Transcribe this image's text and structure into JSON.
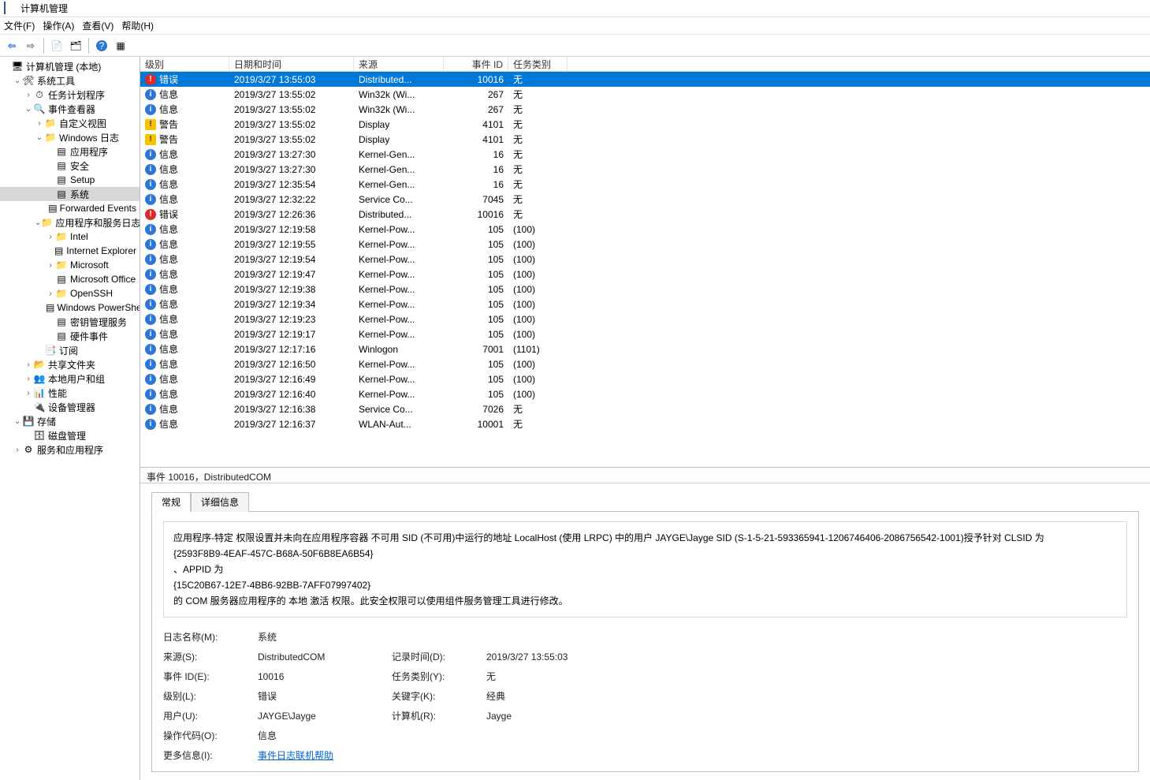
{
  "window": {
    "title": "计算机管理"
  },
  "menu": {
    "file": "文件(F)",
    "action": "操作(A)",
    "view": "查看(V)",
    "help": "帮助(H)"
  },
  "toolbar": {
    "back": "back-arrow",
    "forward": "forward-arrow",
    "up": "folder-up",
    "props": "properties",
    "refresh": "refresh",
    "help": "help",
    "export": "export"
  },
  "tree": [
    {
      "depth": 0,
      "exp": "",
      "icon": "comp",
      "label": "计算机管理 (本地)"
    },
    {
      "depth": 1,
      "exp": "v",
      "icon": "tool",
      "label": "系统工具"
    },
    {
      "depth": 2,
      "exp": ">",
      "icon": "clock",
      "label": "任务计划程序"
    },
    {
      "depth": 2,
      "exp": "v",
      "icon": "ev",
      "label": "事件查看器"
    },
    {
      "depth": 3,
      "exp": ">",
      "icon": "folder",
      "label": "自定义视图"
    },
    {
      "depth": 3,
      "exp": "v",
      "icon": "folder",
      "label": "Windows 日志"
    },
    {
      "depth": 4,
      "exp": "",
      "icon": "log",
      "label": "应用程序"
    },
    {
      "depth": 4,
      "exp": "",
      "icon": "log",
      "label": "安全"
    },
    {
      "depth": 4,
      "exp": "",
      "icon": "log",
      "label": "Setup"
    },
    {
      "depth": 4,
      "exp": "",
      "icon": "log",
      "label": "系统",
      "selected": true
    },
    {
      "depth": 4,
      "exp": "",
      "icon": "log",
      "label": "Forwarded Events"
    },
    {
      "depth": 3,
      "exp": "v",
      "icon": "folder",
      "label": "应用程序和服务日志"
    },
    {
      "depth": 4,
      "exp": ">",
      "icon": "folder",
      "label": "Intel"
    },
    {
      "depth": 4,
      "exp": "",
      "icon": "log",
      "label": "Internet Explorer"
    },
    {
      "depth": 4,
      "exp": ">",
      "icon": "folder",
      "label": "Microsoft"
    },
    {
      "depth": 4,
      "exp": "",
      "icon": "log",
      "label": "Microsoft Office"
    },
    {
      "depth": 4,
      "exp": ">",
      "icon": "folder",
      "label": "OpenSSH"
    },
    {
      "depth": 4,
      "exp": "",
      "icon": "log",
      "label": "Windows PowerShell"
    },
    {
      "depth": 4,
      "exp": "",
      "icon": "log",
      "label": "密钥管理服务"
    },
    {
      "depth": 4,
      "exp": "",
      "icon": "log",
      "label": "硬件事件"
    },
    {
      "depth": 3,
      "exp": "",
      "icon": "sub",
      "label": "订阅"
    },
    {
      "depth": 2,
      "exp": ">",
      "icon": "share",
      "label": "共享文件夹"
    },
    {
      "depth": 2,
      "exp": ">",
      "icon": "users",
      "label": "本地用户和组"
    },
    {
      "depth": 2,
      "exp": ">",
      "icon": "perf",
      "label": "性能"
    },
    {
      "depth": 2,
      "exp": "",
      "icon": "dev",
      "label": "设备管理器"
    },
    {
      "depth": 1,
      "exp": "v",
      "icon": "store",
      "label": "存储"
    },
    {
      "depth": 2,
      "exp": "",
      "icon": "disk",
      "label": "磁盘管理"
    },
    {
      "depth": 1,
      "exp": ">",
      "icon": "svc",
      "label": "服务和应用程序"
    }
  ],
  "columns": {
    "level": "级别",
    "date": "日期和时间",
    "source": "来源",
    "id": "事件 ID",
    "category": "任务类别"
  },
  "events": [
    {
      "lvl": "err",
      "level": "错误",
      "date": "2019/3/27 13:55:03",
      "src": "Distributed...",
      "id": "10016",
      "cat": "无",
      "sel": true
    },
    {
      "lvl": "info",
      "level": "信息",
      "date": "2019/3/27 13:55:02",
      "src": "Win32k (Wi...",
      "id": "267",
      "cat": "无"
    },
    {
      "lvl": "info",
      "level": "信息",
      "date": "2019/3/27 13:55:02",
      "src": "Win32k (Wi...",
      "id": "267",
      "cat": "无"
    },
    {
      "lvl": "warn",
      "level": "警告",
      "date": "2019/3/27 13:55:02",
      "src": "Display",
      "id": "4101",
      "cat": "无"
    },
    {
      "lvl": "warn",
      "level": "警告",
      "date": "2019/3/27 13:55:02",
      "src": "Display",
      "id": "4101",
      "cat": "无"
    },
    {
      "lvl": "info",
      "level": "信息",
      "date": "2019/3/27 13:27:30",
      "src": "Kernel-Gen...",
      "id": "16",
      "cat": "无"
    },
    {
      "lvl": "info",
      "level": "信息",
      "date": "2019/3/27 13:27:30",
      "src": "Kernel-Gen...",
      "id": "16",
      "cat": "无"
    },
    {
      "lvl": "info",
      "level": "信息",
      "date": "2019/3/27 12:35:54",
      "src": "Kernel-Gen...",
      "id": "16",
      "cat": "无"
    },
    {
      "lvl": "info",
      "level": "信息",
      "date": "2019/3/27 12:32:22",
      "src": "Service Co...",
      "id": "7045",
      "cat": "无"
    },
    {
      "lvl": "err",
      "level": "错误",
      "date": "2019/3/27 12:26:36",
      "src": "Distributed...",
      "id": "10016",
      "cat": "无"
    },
    {
      "lvl": "info",
      "level": "信息",
      "date": "2019/3/27 12:19:58",
      "src": "Kernel-Pow...",
      "id": "105",
      "cat": "(100)"
    },
    {
      "lvl": "info",
      "level": "信息",
      "date": "2019/3/27 12:19:55",
      "src": "Kernel-Pow...",
      "id": "105",
      "cat": "(100)"
    },
    {
      "lvl": "info",
      "level": "信息",
      "date": "2019/3/27 12:19:54",
      "src": "Kernel-Pow...",
      "id": "105",
      "cat": "(100)"
    },
    {
      "lvl": "info",
      "level": "信息",
      "date": "2019/3/27 12:19:47",
      "src": "Kernel-Pow...",
      "id": "105",
      "cat": "(100)"
    },
    {
      "lvl": "info",
      "level": "信息",
      "date": "2019/3/27 12:19:38",
      "src": "Kernel-Pow...",
      "id": "105",
      "cat": "(100)"
    },
    {
      "lvl": "info",
      "level": "信息",
      "date": "2019/3/27 12:19:34",
      "src": "Kernel-Pow...",
      "id": "105",
      "cat": "(100)"
    },
    {
      "lvl": "info",
      "level": "信息",
      "date": "2019/3/27 12:19:23",
      "src": "Kernel-Pow...",
      "id": "105",
      "cat": "(100)"
    },
    {
      "lvl": "info",
      "level": "信息",
      "date": "2019/3/27 12:19:17",
      "src": "Kernel-Pow...",
      "id": "105",
      "cat": "(100)"
    },
    {
      "lvl": "info",
      "level": "信息",
      "date": "2019/3/27 12:17:16",
      "src": "Winlogon",
      "id": "7001",
      "cat": "(1101)"
    },
    {
      "lvl": "info",
      "level": "信息",
      "date": "2019/3/27 12:16:50",
      "src": "Kernel-Pow...",
      "id": "105",
      "cat": "(100)"
    },
    {
      "lvl": "info",
      "level": "信息",
      "date": "2019/3/27 12:16:49",
      "src": "Kernel-Pow...",
      "id": "105",
      "cat": "(100)"
    },
    {
      "lvl": "info",
      "level": "信息",
      "date": "2019/3/27 12:16:40",
      "src": "Kernel-Pow...",
      "id": "105",
      "cat": "(100)"
    },
    {
      "lvl": "info",
      "level": "信息",
      "date": "2019/3/27 12:16:38",
      "src": "Service Co...",
      "id": "7026",
      "cat": "无"
    },
    {
      "lvl": "info",
      "level": "信息",
      "date": "2019/3/27 12:16:37",
      "src": "WLAN-Aut...",
      "id": "10001",
      "cat": "无"
    }
  ],
  "detail": {
    "header": "事件 10016，DistributedCOM",
    "tabs": {
      "general": "常规",
      "details": "详细信息"
    },
    "desc_lines": [
      "应用程序-特定 权限设置并未向在应用程序容器 不可用 SID (不可用)中运行的地址 LocalHost (使用 LRPC) 中的用户 JAYGE\\Jayge SID (S-1-5-21-593365941-1206746406-2086756542-1001)授予针对 CLSID 为",
      "{2593F8B9-4EAF-457C-B68A-50F6B8EA6B54}",
      "、APPID 为",
      "{15C20B67-12E7-4BB6-92BB-7AFF07997402}",
      "的 COM 服务器应用程序的 本地 激活 权限。此安全权限可以使用组件服务管理工具进行修改。"
    ],
    "props": {
      "logname_k": "日志名称(M):",
      "logname_v": "系统",
      "source_k": "来源(S):",
      "source_v": "DistributedCOM",
      "logged_k": "记录时间(D):",
      "logged_v": "2019/3/27 13:55:03",
      "eventid_k": "事件 ID(E):",
      "eventid_v": "10016",
      "taskcat_k": "任务类别(Y):",
      "taskcat_v": "无",
      "level_k": "级别(L):",
      "level_v": "错误",
      "keywords_k": "关键字(K):",
      "keywords_v": "经典",
      "user_k": "用户(U):",
      "user_v": "JAYGE\\Jayge",
      "computer_k": "计算机(R):",
      "computer_v": "Jayge",
      "opcode_k": "操作代码(O):",
      "opcode_v": "信息",
      "moreinfo_k": "更多信息(I):",
      "moreinfo_v": "事件日志联机帮助"
    }
  }
}
